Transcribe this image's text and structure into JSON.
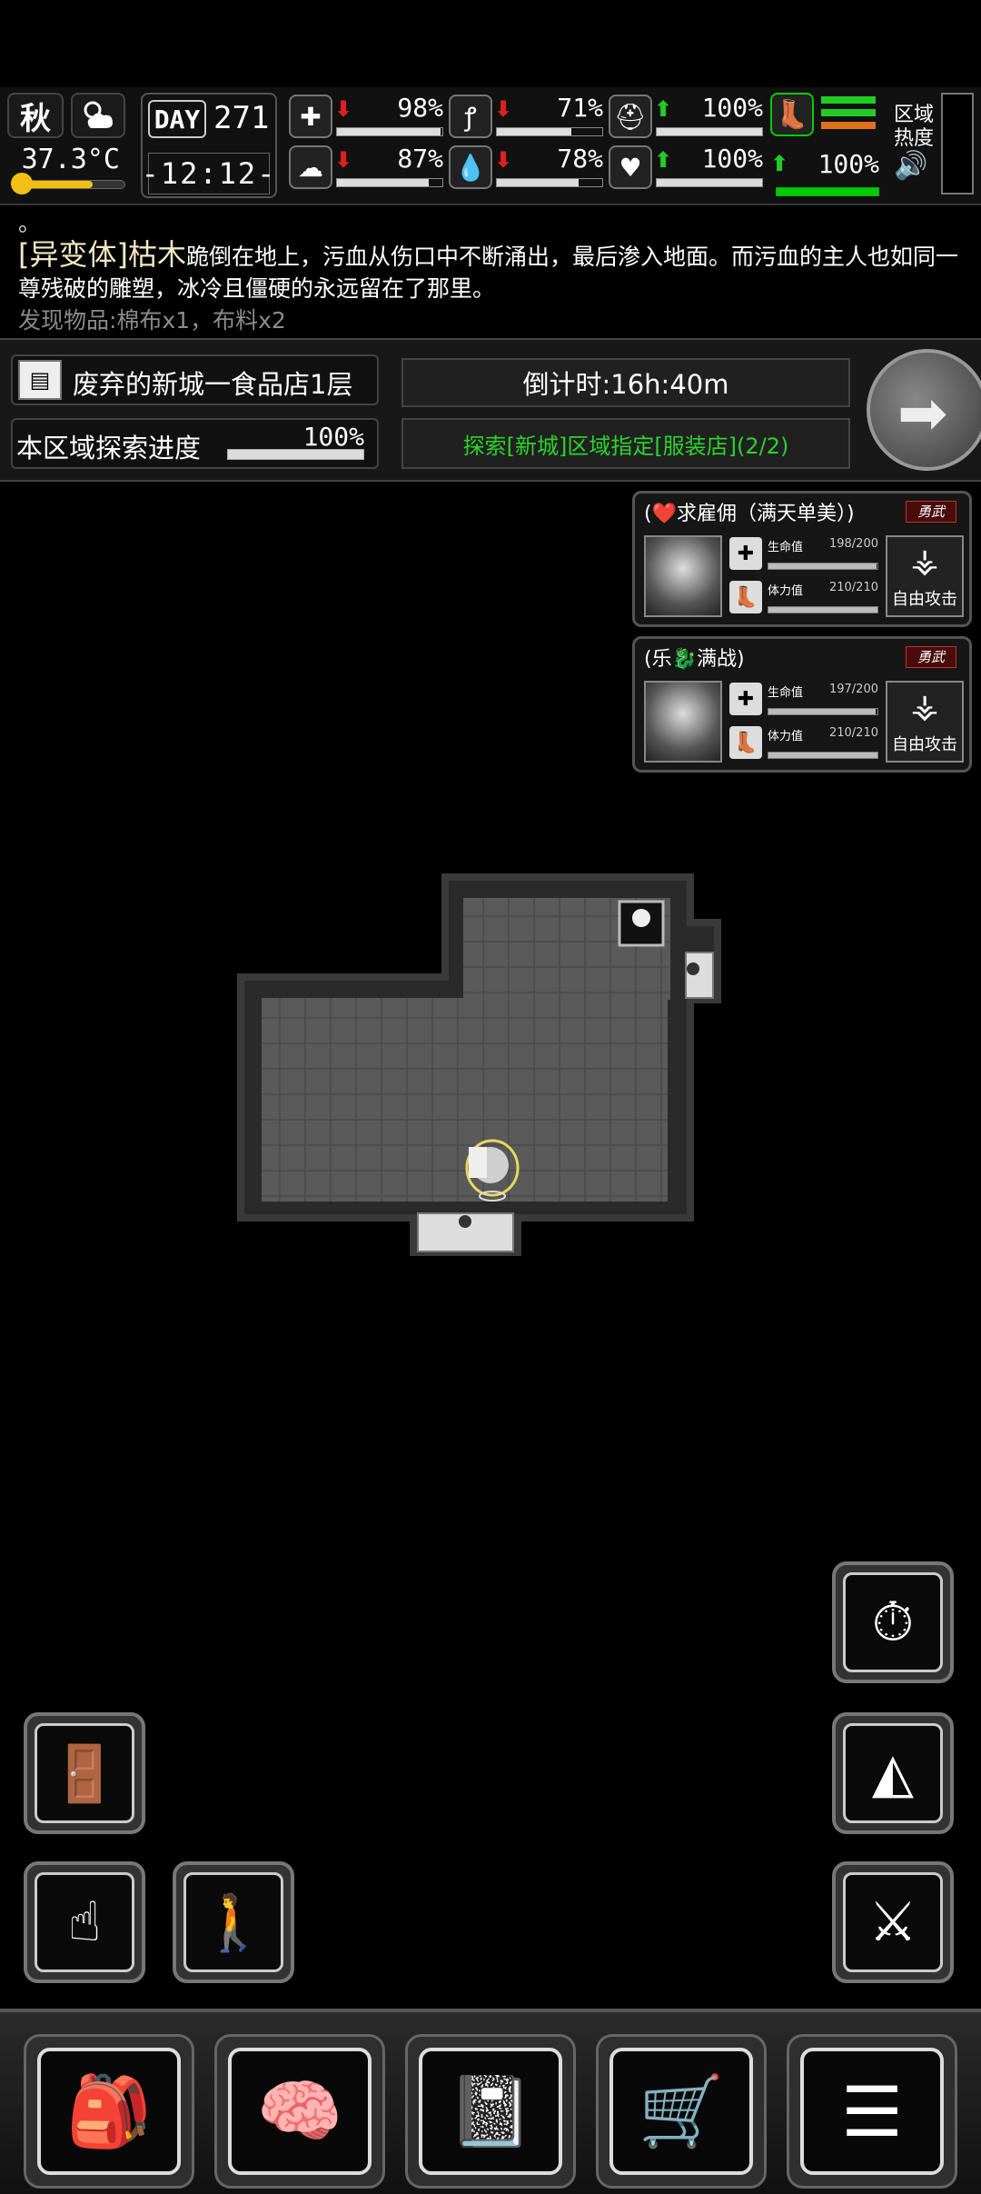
{
  "status": {
    "season": "秋",
    "temperature": "37.3°C",
    "day_label": "DAY",
    "day_number": "271",
    "time": "-12:12-",
    "health_pct": "98%",
    "mood_pct": "87%",
    "hunger_pct": "71%",
    "thirst_pct": "78%",
    "armor_pct": "100%",
    "heart_pct": "100%",
    "stamina_pct": "100%",
    "zone_heat_label": "区域热度"
  },
  "log": {
    "line0": "。",
    "enemy_tag": "[异变体]枯木",
    "message": "跪倒在地上，污血从伤口中不断涌出，最后渗入地面。而污血的主人也如同一尊残破的雕塑，冰冷且僵硬的永远留在了那里。",
    "found": "发现物品:棉布x1，布料x2"
  },
  "location": {
    "name": "废弃的新城一食品店1层",
    "explore_label": "本区域探索进度",
    "explore_pct": "100%",
    "countdown": "倒计时:16h:40m",
    "quest": "探索[新城]区域指定[服装店](2/2)"
  },
  "mercs": [
    {
      "name": "(❤️求雇佣（满天单美）)",
      "brave": "勇武",
      "hp_label": "生命值",
      "hp": "198/200",
      "hp_fill": 0.99,
      "sp_label": "体力值",
      "sp": "210/210",
      "sp_fill": 1.0,
      "attack": "自由攻击"
    },
    {
      "name": "(乐🐉满战)",
      "brave": "勇武",
      "hp_label": "生命值",
      "hp": "197/200",
      "hp_fill": 0.985,
      "sp_label": "体力值",
      "sp": "210/210",
      "sp_fill": 1.0,
      "attack": "自由攻击"
    }
  ],
  "colors": {
    "quest_green": "#2bd32b",
    "log_found_gray": "#8b8b8b",
    "temp_yellow": "#f2c012"
  },
  "icons": {
    "exit": "exit-icon",
    "interact": "tap-icon",
    "walk": "walk-icon",
    "timer": "timer-icon",
    "stance": "stance-icon",
    "squad": "squad-icon",
    "backpack": "backpack-icon",
    "brain": "brain-icon",
    "notes": "notebook-icon",
    "shop": "cart-icon",
    "menu": "menu-icon"
  }
}
